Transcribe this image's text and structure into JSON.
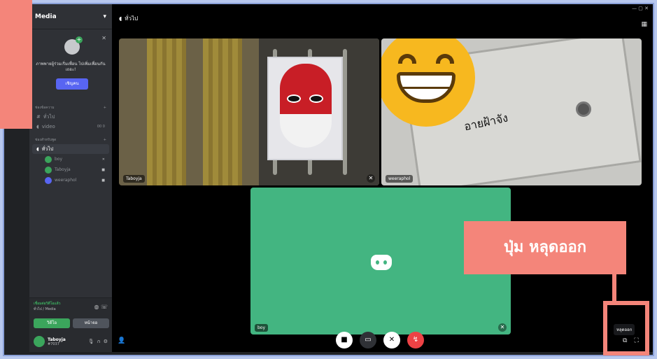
{
  "sidebar": {
    "server_name": "Media",
    "invite": {
      "text": "ภาพพายผู้ร่วมเริ่มเพื่อน ไปเพิ่มเพื่อนกันเถอะ!",
      "button": "เชิญคน"
    },
    "categories": [
      {
        "label": "ช่องข้อความ"
      },
      {
        "label": "ช่องสำหรับพูด"
      }
    ],
    "text_channel": "ทั่วไป",
    "voice_channel_video": {
      "label": "video",
      "badge": "00 0"
    },
    "voice_channel_active": "ทั่วไป",
    "members": [
      {
        "name": "boy"
      },
      {
        "name": "Taboyja"
      },
      {
        "name": "weeraphol"
      }
    ],
    "voice_panel": {
      "status": "เชื่อมต่อวิดีโอแล้ว",
      "sub": "ทั่วไป / Media",
      "video_button": "วิดีโอ",
      "screen_button": "หน้าจอ"
    },
    "user": {
      "name": "Taboyja",
      "tag": "#7037"
    }
  },
  "main": {
    "channel_title": "ทั่วไป",
    "tiles": [
      {
        "label": "Taboyja"
      },
      {
        "label": "weeraphol",
        "overlay": "อายฝ้าจัง"
      },
      {
        "label": "boy"
      }
    ],
    "leave_tooltip": "หลุดออก"
  },
  "annotation": {
    "label": "ปุ่ม หลุดออก"
  },
  "colors": {
    "accent_green": "#43b581",
    "blurple": "#5865f2",
    "danger": "#ed4245",
    "annotation": "#f4857a"
  },
  "icons": [
    "speaker-icon",
    "hash-icon",
    "mic-icon",
    "headphones-icon",
    "gear-icon",
    "camera-icon",
    "screen-share-icon",
    "leave-call-icon",
    "popout-icon",
    "fullscreen-icon",
    "add-user-icon",
    "grid-layout-icon"
  ]
}
